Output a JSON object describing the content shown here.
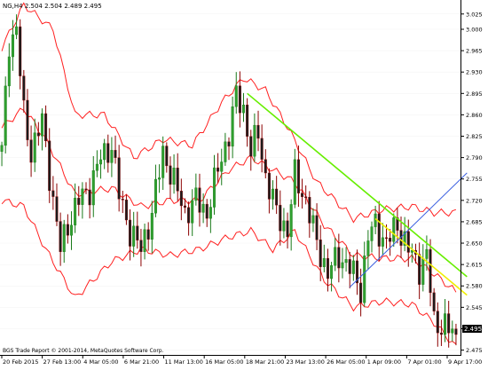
{
  "window": {
    "header_text": "NG,H4  2.504 2.504 2.489 2.495",
    "copyright_text": "BGS Trade Report © 2001-2014, MetaQuotes Software Corp.",
    "current_price_label": "2.495"
  },
  "colors": {
    "background": "#ffffff",
    "candle_bull": "#1a7a1a",
    "candle_bear": "#8b0000",
    "bollinger": "#ff2020",
    "trendline_green": "#66ee00",
    "trendline_yellow": "#eeee00",
    "trendline_blue": "#3a5fe0",
    "axis_text": "#000000",
    "price_label_bg": "#000000",
    "price_label_text": "#ffffff"
  },
  "chart_data": {
    "type": "candlestick",
    "symbol": "NG",
    "timeframe": "H4",
    "ylim": [
      2.47,
      3.045
    ],
    "y_ticks": [
      3.025,
      3.0,
      2.965,
      2.93,
      2.895,
      2.86,
      2.825,
      2.79,
      2.755,
      2.72,
      2.685,
      2.65,
      2.615,
      2.58,
      2.545,
      2.51,
      2.475
    ],
    "x_tick_labels": [
      "20 Feb 2015",
      "27 Feb 13:00",
      "4 Mar 05:00",
      "6 Mar 21:00",
      "11 Mar 13:00",
      "16 Mar 05:00",
      "18 Mar 21:00",
      "23 Mar 13:00",
      "26 Mar 05:00",
      "1 Apr 09:00",
      "7 Apr 01:00",
      "9 Apr 17:00"
    ],
    "n_bars": 125,
    "candles_ohlc_keyframes": [
      {
        "i": 0,
        "price": 2.8
      },
      {
        "i": 2,
        "price": 2.98
      },
      {
        "i": 4,
        "price": 3.0
      },
      {
        "i": 6,
        "price": 2.86
      },
      {
        "i": 8,
        "price": 2.8
      },
      {
        "i": 11,
        "price": 2.85
      },
      {
        "i": 14,
        "price": 2.72
      },
      {
        "i": 16,
        "price": 2.64
      },
      {
        "i": 18,
        "price": 2.68
      },
      {
        "i": 21,
        "price": 2.72
      },
      {
        "i": 24,
        "price": 2.74
      },
      {
        "i": 27,
        "price": 2.79
      },
      {
        "i": 30,
        "price": 2.81
      },
      {
        "i": 32,
        "price": 2.73
      },
      {
        "i": 35,
        "price": 2.67
      },
      {
        "i": 38,
        "price": 2.64
      },
      {
        "i": 41,
        "price": 2.7
      },
      {
        "i": 44,
        "price": 2.8
      },
      {
        "i": 47,
        "price": 2.75
      },
      {
        "i": 50,
        "price": 2.7
      },
      {
        "i": 53,
        "price": 2.72
      },
      {
        "i": 56,
        "price": 2.7
      },
      {
        "i": 59,
        "price": 2.77
      },
      {
        "i": 62,
        "price": 2.83
      },
      {
        "i": 64,
        "price": 2.89
      },
      {
        "i": 66,
        "price": 2.87
      },
      {
        "i": 68,
        "price": 2.8
      },
      {
        "i": 70,
        "price": 2.83
      },
      {
        "i": 72,
        "price": 2.76
      },
      {
        "i": 75,
        "price": 2.7
      },
      {
        "i": 78,
        "price": 2.67
      },
      {
        "i": 80,
        "price": 2.76
      },
      {
        "i": 83,
        "price": 2.72
      },
      {
        "i": 86,
        "price": 2.65
      },
      {
        "i": 89,
        "price": 2.6
      },
      {
        "i": 92,
        "price": 2.63
      },
      {
        "i": 95,
        "price": 2.61
      },
      {
        "i": 98,
        "price": 2.575
      },
      {
        "i": 100,
        "price": 2.66
      },
      {
        "i": 102,
        "price": 2.68
      },
      {
        "i": 105,
        "price": 2.65
      },
      {
        "i": 108,
        "price": 2.68
      },
      {
        "i": 111,
        "price": 2.64
      },
      {
        "i": 114,
        "price": 2.61
      },
      {
        "i": 116,
        "price": 2.63
      },
      {
        "i": 118,
        "price": 2.52
      },
      {
        "i": 121,
        "price": 2.515
      },
      {
        "i": 124,
        "price": 2.495
      }
    ],
    "last_price": 2.495,
    "bollinger": {
      "middle_keyframes": [
        {
          "i": 0,
          "price": 2.84
        },
        {
          "i": 6,
          "price": 2.87
        },
        {
          "i": 12,
          "price": 2.82
        },
        {
          "i": 20,
          "price": 2.73
        },
        {
          "i": 30,
          "price": 2.74
        },
        {
          "i": 38,
          "price": 2.71
        },
        {
          "i": 46,
          "price": 2.72
        },
        {
          "i": 54,
          "price": 2.72
        },
        {
          "i": 62,
          "price": 2.77
        },
        {
          "i": 68,
          "price": 2.79
        },
        {
          "i": 74,
          "price": 2.77
        },
        {
          "i": 80,
          "price": 2.75
        },
        {
          "i": 88,
          "price": 2.68
        },
        {
          "i": 96,
          "price": 2.63
        },
        {
          "i": 104,
          "price": 2.625
        },
        {
          "i": 112,
          "price": 2.625
        },
        {
          "i": 118,
          "price": 2.6
        },
        {
          "i": 124,
          "price": 2.57
        }
      ],
      "upper_keyframes": [
        {
          "i": 0,
          "price": 2.97
        },
        {
          "i": 6,
          "price": 3.04
        },
        {
          "i": 14,
          "price": 3.0
        },
        {
          "i": 20,
          "price": 2.86
        },
        {
          "i": 28,
          "price": 2.86
        },
        {
          "i": 36,
          "price": 2.79
        },
        {
          "i": 44,
          "price": 2.82
        },
        {
          "i": 52,
          "price": 2.81
        },
        {
          "i": 60,
          "price": 2.88
        },
        {
          "i": 66,
          "price": 2.92
        },
        {
          "i": 72,
          "price": 2.9
        },
        {
          "i": 78,
          "price": 2.84
        },
        {
          "i": 86,
          "price": 2.75
        },
        {
          "i": 96,
          "price": 2.69
        },
        {
          "i": 104,
          "price": 2.705
        },
        {
          "i": 112,
          "price": 2.71
        },
        {
          "i": 118,
          "price": 2.7
        },
        {
          "i": 124,
          "price": 2.7
        }
      ],
      "lower_keyframes": [
        {
          "i": 0,
          "price": 2.72
        },
        {
          "i": 6,
          "price": 2.71
        },
        {
          "i": 12,
          "price": 2.64
        },
        {
          "i": 20,
          "price": 2.56
        },
        {
          "i": 30,
          "price": 2.62
        },
        {
          "i": 38,
          "price": 2.64
        },
        {
          "i": 46,
          "price": 2.63
        },
        {
          "i": 54,
          "price": 2.64
        },
        {
          "i": 62,
          "price": 2.66
        },
        {
          "i": 68,
          "price": 2.67
        },
        {
          "i": 74,
          "price": 2.64
        },
        {
          "i": 80,
          "price": 2.67
        },
        {
          "i": 88,
          "price": 2.59
        },
        {
          "i": 96,
          "price": 2.545
        },
        {
          "i": 104,
          "price": 2.555
        },
        {
          "i": 112,
          "price": 2.55
        },
        {
          "i": 118,
          "price": 2.52
        },
        {
          "i": 124,
          "price": 2.48
        }
      ]
    },
    "trendlines": [
      {
        "name": "green",
        "from": {
          "i": 67,
          "price": 2.895
        },
        "to": {
          "i": 127,
          "price": 2.595
        }
      },
      {
        "name": "yellow",
        "from": {
          "i": 102,
          "price": 2.69
        },
        "to": {
          "i": 127,
          "price": 2.565
        }
      },
      {
        "name": "blue",
        "from": {
          "i": 95,
          "price": 2.578
        },
        "to": {
          "i": 127,
          "price": 2.765
        }
      }
    ]
  }
}
